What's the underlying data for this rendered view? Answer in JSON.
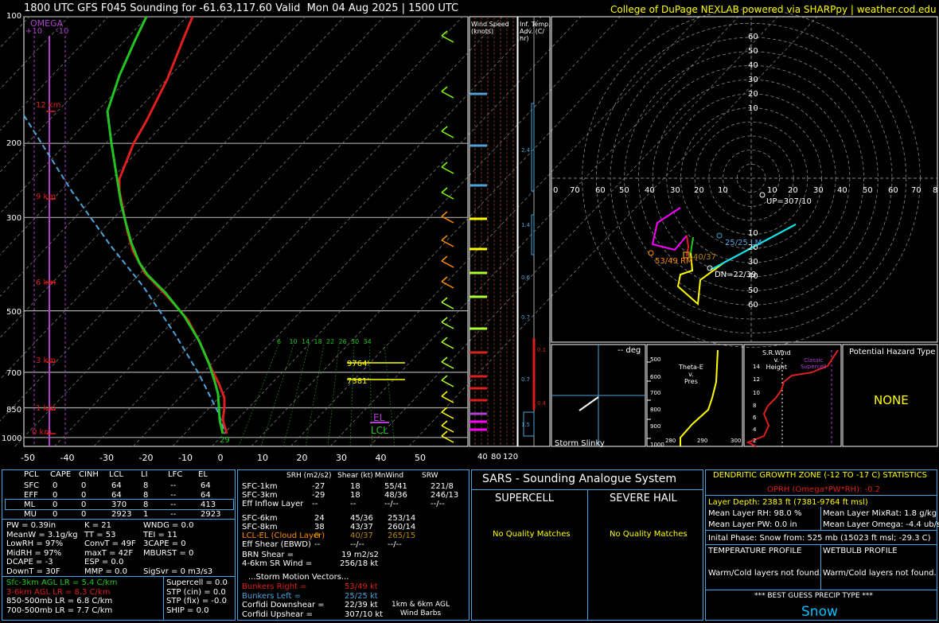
{
  "header": {
    "title": "1800 UTC GFS F045 Sounding for -61.63,117.60 Valid  Mon 04 Aug 2025 | 1500 UTC",
    "credit": "College of DuPage NEXLAB powered via SHARPpy | weather.cod.edu"
  },
  "colors": {
    "temp": "#dd1f1f",
    "dew": "#22c422",
    "wetbulb": "#4ea3d9",
    "omega": "#b040d0",
    "yellow": "#ffff00",
    "panel_border": "#4ea3d9"
  },
  "skewt": {
    "pressure_labels": [
      "100",
      "200",
      "300",
      "500",
      "700",
      "850",
      "1000"
    ],
    "temp_ticks": [
      "-50",
      "-40",
      "-30",
      "-20",
      "-10",
      "0",
      "10",
      "20",
      "30",
      "40",
      "50"
    ],
    "height_labels": [
      "12 km",
      "9 km",
      "6 km",
      "3 km",
      "1 km",
      "0 km"
    ],
    "omega_title": "OMEGA",
    "omega_ticks": [
      "+10",
      "-10"
    ],
    "surface_dewpoint": "29",
    "el_label": "EL",
    "lcl_label": "LCL",
    "level_9764": "9764'",
    "level_7381": "7381'",
    "mixing_ratio_labels": [
      "6",
      "10",
      "14",
      "18",
      "22",
      "26",
      "30",
      "34"
    ]
  },
  "windspeed_panel": {
    "title": "Wind Speed\n(knots)",
    "ticks": [
      "40",
      "80",
      "120"
    ]
  },
  "tadv_panel": {
    "title": "Inf. Temp.\nAdv. (C/\nhr)",
    "values": [
      "2.4",
      "1.4",
      "0.6",
      "0.7",
      "0.7",
      "0.1",
      "0.4",
      "1.5"
    ]
  },
  "hodograph": {
    "ring_labels": [
      "60",
      "50",
      "40",
      "30",
      "20",
      "10",
      "10",
      "20",
      "30",
      "40",
      "50",
      "60"
    ],
    "x_labels": [
      "0",
      "70",
      "60",
      "50",
      "40",
      "30",
      "20",
      "10",
      "10",
      "20",
      "30",
      "40",
      "50",
      "60",
      "70",
      "8"
    ],
    "up": "UP=307/10",
    "lm": "25/25 LM",
    "rm": "53/49 RM",
    "lcl_mean": "40/37",
    "dn": "DN=22/39"
  },
  "slinky": {
    "deg": "-- deg",
    "label": "Storm Slinky"
  },
  "theta": {
    "title": "Theta-E\nv.\nPres",
    "ylabels": [
      "500",
      "600",
      "700",
      "800",
      "900",
      "1000"
    ],
    "xlabels": [
      "280",
      "290",
      "300"
    ]
  },
  "srwind": {
    "title": "S.R.Wind\nv.\nHeight",
    "ylabels": [
      "14",
      "12",
      "10",
      "8",
      "6",
      "4",
      "2"
    ],
    "classic": "Classic\nSupercell"
  },
  "hazard": {
    "title": "Potential Hazard Type",
    "value": "NONE"
  },
  "parcels": {
    "headers": [
      "PCL",
      "CAPE",
      "CINH",
      "LCL",
      "LI",
      "LFC",
      "EL"
    ],
    "rows": [
      [
        "SFC",
        "0",
        "0",
        "64",
        "8",
        "--",
        "64"
      ],
      [
        "EFF",
        "0",
        "0",
        "64",
        "8",
        "--",
        "64"
      ],
      [
        "ML",
        "0",
        "0",
        "370",
        "8",
        "--",
        "413"
      ],
      [
        "MU",
        "0",
        "0",
        "2923",
        "1",
        "--",
        "2923"
      ]
    ]
  },
  "indices": [
    [
      "PW = 0.39in",
      "K = 21",
      "WNDG = 0.0"
    ],
    [
      "MeanW = 3.1g/kg",
      "TT = 53",
      "TEI = 11"
    ],
    [
      "LowRH = 97%",
      "ConvT = 49F",
      "3CAPE = 0"
    ],
    [
      "MidRH = 97%",
      "maxT = 42F",
      "MBURST = 0"
    ],
    [
      "DCAPE = -3",
      "ESP = 0.0",
      ""
    ],
    [
      "DownT = 30F",
      "MMP = 0.0",
      "SigSvr = 0 m3/s3"
    ]
  ],
  "lapse": [
    "Sfc-3km AGL LR = 5.4 C/km",
    "3-6km AGL LR = 8.3 C/km",
    "850-500mb LR = 6.8 C/km",
    "700-500mb LR = 7.7 C/km"
  ],
  "params": [
    "Supercell = 0.0",
    "STP (cin) = 0.0",
    "STP (fix) = -0.0",
    "SHIP = 0.0"
  ],
  "kinematics": {
    "headers": [
      "SRH (m2/s2)",
      "Shear (kt)",
      "MnWind",
      "SRW"
    ],
    "rows": [
      [
        "SFC-1km",
        "-27",
        "18",
        "55/41",
        "221/8"
      ],
      [
        "SFC-3km",
        "-29",
        "18",
        "48/36",
        "246/13"
      ],
      [
        "Eff Inflow Layer",
        "--",
        "--",
        "--/--",
        "--/--"
      ],
      [
        "",
        "",
        " ",
        "",
        ""
      ],
      [
        "SFC-6km",
        "24",
        "45/36",
        "253/14",
        ""
      ],
      [
        "SFC-8km",
        "38",
        "43/37",
        "260/14",
        ""
      ],
      [
        "LCL-EL (Cloud Layer)",
        "0",
        "40/37",
        "265/15",
        ""
      ],
      [
        "Eff Shear (EBWD)",
        "--",
        "--/--",
        "--/--",
        ""
      ]
    ],
    "brn": [
      "BRN Shear =",
      "19 m2/s2"
    ],
    "sr46": [
      "4-6km SR Wind =",
      "256/18 kt"
    ],
    "storm_title": "...Storm Motion Vectors...",
    "motions": [
      [
        "Bunkers Right =",
        "53/49 kt"
      ],
      [
        "Bunkers Left =",
        "25/25 kt"
      ],
      [
        "Corfidi Downshear =",
        "22/39 kt"
      ],
      [
        "Corfidi Upshear =",
        "307/10 kt"
      ]
    ],
    "barbs_label": "1km & 6km AGL\nWind Barbs"
  },
  "sars": {
    "title": "SARS - Sounding Analogue System",
    "supercell": "SUPERCELL",
    "hail": "SEVERE HAIL",
    "sc_result": "No Quality Matches",
    "hail_result": "No Quality Matches"
  },
  "dgz": {
    "title": "DENDRITIC GROWTH ZONE (-12 TO -17 C) STATISTICS",
    "oprh": "OPRH (Omega*PW*RH): -0.2",
    "depth": "Layer Depth: 2383 ft (7381-9764 ft msl)",
    "rh": "Mean Layer RH: 98.0 %",
    "mix": "Mean Layer MixRat: 1.8 g/kg",
    "pw": "Mean Layer PW: 0.0 in",
    "omega": "Mean Layer Omega: -4.4 ub/s",
    "phase": "Inital Phase: Snow from: 525 mb (15023 ft msl; -29.3 C)",
    "temp_title": "TEMPERATURE PROFILE",
    "wb_title": "WETBULB PROFILE",
    "temp_val": "Warm/Cold layers not found.",
    "wb_val": "Warm/Cold layers not found.",
    "precip_title": "*** BEST GUESS PRECIP TYPE ***",
    "precip": "Snow"
  },
  "chart_data": {
    "type": "line",
    "title": "1800 UTC GFS F045 Sounding for -61.63,117.60 Valid  Mon 04 Aug 2025 | 1500 UTC",
    "xlabel": "",
    "ylabel": "",
    "xlim": [
      -50,
      50
    ],
    "ylim": [
      1000,
      100
    ],
    "y_scale": "log",
    "series": [
      {
        "name": "",
        "pressure": [
          1000,
          950,
          900,
          850,
          800,
          750,
          700,
          600,
          500,
          400,
          300,
          250,
          200,
          150,
          100
        ],
        "values": [
          1.5,
          0.5,
          0.5,
          1.0,
          -1.0,
          -4.0,
          -8.0,
          -17.0,
          -26.0,
          -37.0,
          -51.0,
          -55.0,
          -50.0,
          -47.0,
          -44.0
        ]
      },
      {
        "name": "",
        "pressure": [
          1000,
          950,
          900,
          850,
          800,
          750,
          700,
          600,
          500,
          400,
          300,
          250,
          200,
          150,
          100
        ],
        "values": [
          -0.5,
          -0.8,
          -1.0,
          -1.5,
          -3.0,
          -5.0,
          -9.0,
          -18.0,
          -28.0,
          -40.0,
          -55.0,
          -60.0,
          -62.0,
          -65.0,
          -70.0
        ]
      }
    ]
  }
}
